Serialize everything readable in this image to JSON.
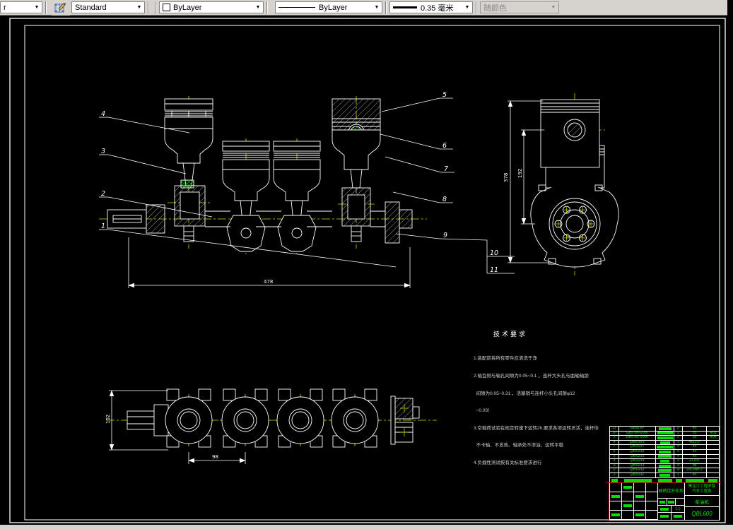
{
  "toolbar": {
    "layer_value": "r",
    "style_value": "Standard",
    "color_value": "ByLayer",
    "linetype_value": "ByLayer",
    "lineweight_value": "0.35 毫米",
    "plotstyle_value": "随颜色"
  },
  "drawing": {
    "balloons": [
      "1",
      "2",
      "3",
      "4",
      "5",
      "6",
      "7",
      "8",
      "9",
      "10",
      "11"
    ],
    "dims": {
      "overall": "478",
      "side_total": "378",
      "side_span": "192",
      "web": "102",
      "pitch": "98"
    },
    "tech": {
      "title": "技术要求",
      "lines": [
        "1.装配前将所有零件应清洗干净",
        "2.轴瓦侧与轴孔间隙为0.05~0.1 ，连杆大头孔与曲轴轴颈",
        "  间隙为0.05~0.31 ，活塞销与连杆小头孔间隙φ12",
        "  ~0.03）",
        "3.空载荷试验在规定转速下运转2h,要求各项运转灵活，连杆体",
        "  不卡轴、不发热、轴承处不渗油、运转平稳",
        "4.负载性测试按有关标准要求进行"
      ]
    }
  },
  "bom": {
    "rows": [
      {
        "no": "11",
        "code": "GB93-87",
        "qty": "2",
        "mat": "45",
        "note": ""
      },
      {
        "no": "10",
        "code": "GB5780-2000",
        "qty": "1",
        "mat": "35",
        "note": "组合"
      },
      {
        "no": "9",
        "code": "GB5781-2000",
        "qty": "1",
        "mat": "35",
        "note": "组合"
      },
      {
        "no": "8",
        "code": "QB0.00-2",
        "qty": "1",
        "mat": "40Cr-2",
        "note": ""
      },
      {
        "no": "7",
        "code": "QB.0217",
        "qty": "4",
        "mat": "45",
        "note": ""
      },
      {
        "no": "6",
        "code": "QB.0216",
        "qty": "4",
        "mat": "45",
        "note": ""
      },
      {
        "no": "5",
        "code": "QB.0215",
        "qty": "4",
        "mat": "45",
        "note": ""
      },
      {
        "no": "4",
        "code": "QB.0214",
        "qty": "4",
        "mat": "ZL102",
        "note": ""
      },
      {
        "no": "3",
        "code": "QB.0213",
        "qty": "4",
        "mat": "38",
        "note": ""
      },
      {
        "no": "2",
        "code": "QB.0212",
        "qty": "4",
        "mat": "20CrMnTi",
        "note": ""
      },
      {
        "no": "1",
        "code": "QB.0211",
        "qty": "1",
        "mat": "45",
        "note": ""
      }
    ]
  },
  "titleblock": {
    "title": "曲柄连杆机构",
    "org_line1": "黑龙江工程学院",
    "org_line2": "汽车工程系",
    "product": "柴油机",
    "drawing_no": "QBL600",
    "scale": "1:1"
  },
  "colors": {
    "line": "#ffffff",
    "centerline": "#d4d400",
    "accent_green": "#00dd00",
    "accent_red": "#c40000"
  }
}
